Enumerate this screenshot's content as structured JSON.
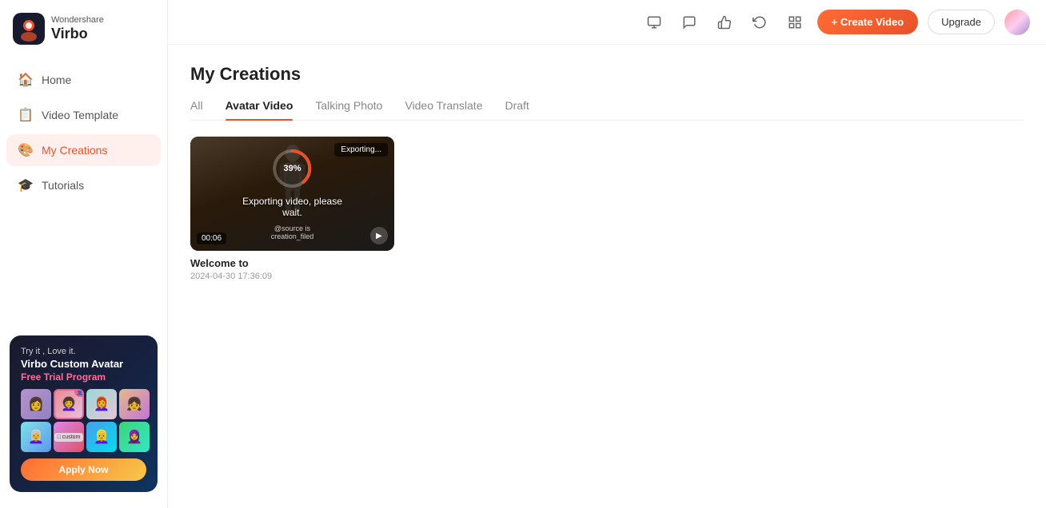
{
  "app": {
    "brand_top": "Wondershare",
    "brand_bottom": "Virbo"
  },
  "sidebar": {
    "items": [
      {
        "id": "home",
        "label": "Home",
        "icon": "🏠",
        "active": false
      },
      {
        "id": "video-template",
        "label": "Video Template",
        "icon": "📋",
        "active": false
      },
      {
        "id": "my-creations",
        "label": "My Creations",
        "icon": "🎨",
        "active": true
      },
      {
        "id": "tutorials",
        "label": "Tutorials",
        "icon": "🎓",
        "active": false
      }
    ]
  },
  "promo": {
    "try_it": "Try it , Love it.",
    "title": "Virbo Custom Avatar",
    "subtitle": "Free Trial Program",
    "button_label": "Apply Now"
  },
  "header": {
    "create_button": "+ Create Video",
    "upgrade_button": "Upgrade"
  },
  "main": {
    "page_title": "My Creations",
    "tabs": [
      {
        "label": "All",
        "active": false
      },
      {
        "label": "Avatar Video",
        "active": true
      },
      {
        "label": "Talking Photo",
        "active": false
      },
      {
        "label": "Video Translate",
        "active": false
      },
      {
        "label": "Draft",
        "active": false
      }
    ],
    "videos": [
      {
        "title": "Welcome to",
        "date": "2024-04-30 17:36:09",
        "duration": "00:06",
        "exporting": true,
        "export_badge": "Exporting...",
        "progress": 39,
        "export_text": "Exporting video, please wait.",
        "export_subtext": "@source is\ncreation_filed"
      }
    ]
  },
  "colors": {
    "accent": "#e8522a",
    "active_nav_bg": "#fff0ee",
    "active_nav_text": "#e8522a",
    "progress_ring_bg": "rgba(255,255,255,0.3)",
    "progress_ring_fill": "#e8522a"
  }
}
